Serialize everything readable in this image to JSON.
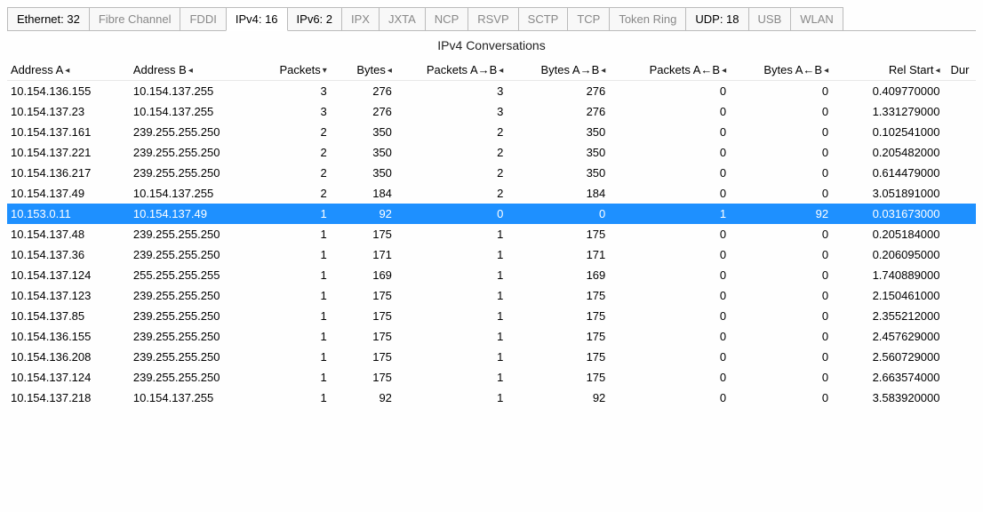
{
  "tabs": [
    {
      "label": "Ethernet: 32",
      "hasCount": true,
      "active": false
    },
    {
      "label": "Fibre Channel",
      "hasCount": false,
      "active": false
    },
    {
      "label": "FDDI",
      "hasCount": false,
      "active": false
    },
    {
      "label": "IPv4: 16",
      "hasCount": true,
      "active": true
    },
    {
      "label": "IPv6: 2",
      "hasCount": true,
      "active": false
    },
    {
      "label": "IPX",
      "hasCount": false,
      "active": false
    },
    {
      "label": "JXTA",
      "hasCount": false,
      "active": false
    },
    {
      "label": "NCP",
      "hasCount": false,
      "active": false
    },
    {
      "label": "RSVP",
      "hasCount": false,
      "active": false
    },
    {
      "label": "SCTP",
      "hasCount": false,
      "active": false
    },
    {
      "label": "TCP",
      "hasCount": false,
      "active": false
    },
    {
      "label": "Token Ring",
      "hasCount": false,
      "active": false
    },
    {
      "label": "UDP: 18",
      "hasCount": true,
      "active": false
    },
    {
      "label": "USB",
      "hasCount": false,
      "active": false
    },
    {
      "label": "WLAN",
      "hasCount": false,
      "active": false
    }
  ],
  "title": "IPv4 Conversations",
  "columns": [
    {
      "label": "Address A",
      "sort": "◂"
    },
    {
      "label": "Address B",
      "sort": "◂"
    },
    {
      "label": "Packets",
      "sort": "▾"
    },
    {
      "label": "Bytes",
      "sort": "◂"
    },
    {
      "label": "Packets A→B",
      "sort": "◂"
    },
    {
      "label": "Bytes A→B",
      "sort": "◂"
    },
    {
      "label": "Packets A←B",
      "sort": "◂"
    },
    {
      "label": "Bytes A←B",
      "sort": "◂"
    },
    {
      "label": "Rel Start",
      "sort": "◂"
    },
    {
      "label": "Dur",
      "sort": ""
    }
  ],
  "rows": [
    {
      "a": "10.154.136.155",
      "b": "10.154.137.255",
      "p": 3,
      "by": 276,
      "pab": 3,
      "bab": 276,
      "pba": 0,
      "bba": 0,
      "rel": "0.409770000",
      "sel": false
    },
    {
      "a": "10.154.137.23",
      "b": "10.154.137.255",
      "p": 3,
      "by": 276,
      "pab": 3,
      "bab": 276,
      "pba": 0,
      "bba": 0,
      "rel": "1.331279000",
      "sel": false
    },
    {
      "a": "10.154.137.161",
      "b": "239.255.255.250",
      "p": 2,
      "by": 350,
      "pab": 2,
      "bab": 350,
      "pba": 0,
      "bba": 0,
      "rel": "0.102541000",
      "sel": false
    },
    {
      "a": "10.154.137.221",
      "b": "239.255.255.250",
      "p": 2,
      "by": 350,
      "pab": 2,
      "bab": 350,
      "pba": 0,
      "bba": 0,
      "rel": "0.205482000",
      "sel": false
    },
    {
      "a": "10.154.136.217",
      "b": "239.255.255.250",
      "p": 2,
      "by": 350,
      "pab": 2,
      "bab": 350,
      "pba": 0,
      "bba": 0,
      "rel": "0.614479000",
      "sel": false
    },
    {
      "a": "10.154.137.49",
      "b": "10.154.137.255",
      "p": 2,
      "by": 184,
      "pab": 2,
      "bab": 184,
      "pba": 0,
      "bba": 0,
      "rel": "3.051891000",
      "sel": false
    },
    {
      "a": "10.153.0.11",
      "b": "10.154.137.49",
      "p": 1,
      "by": 92,
      "pab": 0,
      "bab": 0,
      "pba": 1,
      "bba": 92,
      "rel": "0.031673000",
      "sel": true
    },
    {
      "a": "10.154.137.48",
      "b": "239.255.255.250",
      "p": 1,
      "by": 175,
      "pab": 1,
      "bab": 175,
      "pba": 0,
      "bba": 0,
      "rel": "0.205184000",
      "sel": false
    },
    {
      "a": "10.154.137.36",
      "b": "239.255.255.250",
      "p": 1,
      "by": 171,
      "pab": 1,
      "bab": 171,
      "pba": 0,
      "bba": 0,
      "rel": "0.206095000",
      "sel": false
    },
    {
      "a": "10.154.137.124",
      "b": "255.255.255.255",
      "p": 1,
      "by": 169,
      "pab": 1,
      "bab": 169,
      "pba": 0,
      "bba": 0,
      "rel": "1.740889000",
      "sel": false
    },
    {
      "a": "10.154.137.123",
      "b": "239.255.255.250",
      "p": 1,
      "by": 175,
      "pab": 1,
      "bab": 175,
      "pba": 0,
      "bba": 0,
      "rel": "2.150461000",
      "sel": false
    },
    {
      "a": "10.154.137.85",
      "b": "239.255.255.250",
      "p": 1,
      "by": 175,
      "pab": 1,
      "bab": 175,
      "pba": 0,
      "bba": 0,
      "rel": "2.355212000",
      "sel": false
    },
    {
      "a": "10.154.136.155",
      "b": "239.255.255.250",
      "p": 1,
      "by": 175,
      "pab": 1,
      "bab": 175,
      "pba": 0,
      "bba": 0,
      "rel": "2.457629000",
      "sel": false
    },
    {
      "a": "10.154.136.208",
      "b": "239.255.255.250",
      "p": 1,
      "by": 175,
      "pab": 1,
      "bab": 175,
      "pba": 0,
      "bba": 0,
      "rel": "2.560729000",
      "sel": false
    },
    {
      "a": "10.154.137.124",
      "b": "239.255.255.250",
      "p": 1,
      "by": 175,
      "pab": 1,
      "bab": 175,
      "pba": 0,
      "bba": 0,
      "rel": "2.663574000",
      "sel": false
    },
    {
      "a": "10.154.137.218",
      "b": "10.154.137.255",
      "p": 1,
      "by": 92,
      "pab": 1,
      "bab": 92,
      "pba": 0,
      "bba": 0,
      "rel": "3.583920000",
      "sel": false
    }
  ]
}
